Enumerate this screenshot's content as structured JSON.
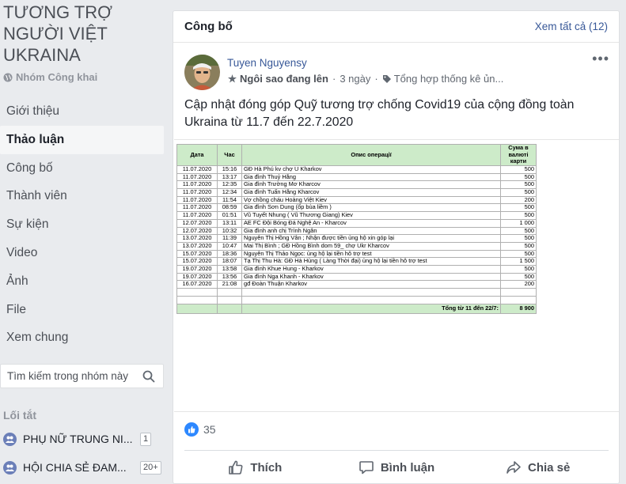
{
  "group": {
    "title": "TƯƠNG TRỢ NGƯỜI VIỆT UKRAINA",
    "privacy": "Nhóm Công khai"
  },
  "nav": [
    {
      "label": "Giới thiệu"
    },
    {
      "label": "Thảo luận"
    },
    {
      "label": "Công bố"
    },
    {
      "label": "Thành viên"
    },
    {
      "label": "Sự kiện"
    },
    {
      "label": "Video"
    },
    {
      "label": "Ảnh"
    },
    {
      "label": "File"
    },
    {
      "label": "Xem chung"
    }
  ],
  "search": {
    "placeholder": "Tìm kiếm trong nhóm này"
  },
  "shortcuts": {
    "title": "Lối tắt",
    "items": [
      {
        "label": "PHỤ NỮ TRUNG NI...",
        "badge": "1"
      },
      {
        "label": "HỘI CHIA SẺ ĐAM...",
        "badge": "20+"
      }
    ]
  },
  "card": {
    "title": "Công bố",
    "see_all": "Xem tất cả (12)"
  },
  "post": {
    "author": "Tuyen Nguyensy",
    "badge": "Ngôi sao đang lên",
    "time": "3 ngày",
    "tag": "Tổng hợp thống kê ủn...",
    "text": "Cập nhật đóng góp Quỹ tương trợ chống Covid19 của cộng đồng toàn Ukraina từ 11.7 đến 22.7.2020",
    "reaction_count": "35"
  },
  "sheet": {
    "headers": [
      "Дата",
      "Час",
      "Опис операції",
      "Сума в валюті карти"
    ],
    "rows": [
      [
        "11.07.2020",
        "15:16",
        "  GĐ Hà Phú kv  chợ U Kharkov",
        "500"
      ],
      [
        "11.07.2020",
        "13:17",
        "  Gia đình Thuỷ Hằng",
        "500"
      ],
      [
        "11.07.2020",
        "12:35",
        "Gia đình Trường Mơ Kharcov",
        "500"
      ],
      [
        "11.07.2020",
        "12:34",
        "Gia đình Tuấn Hằng Kharcov",
        "500"
      ],
      [
        "11.07.2020",
        "11:54",
        "Vợ chồng cháu Hoàng Việt Kiev",
        "200"
      ],
      [
        "11.07.2020",
        "08:59",
        "Gia đình Sơn Dung (ốp bùa liềm )",
        "500"
      ],
      [
        "11.07.2020",
        "01:51",
        "Vũ Tuyết Nhung ( Vũ Thương Giang) Kiev",
        "500"
      ],
      [
        "12.07.2020",
        "13:11",
        "AE FC Đội Bóng Đá Nghệ An - Kharcov",
        "1 000"
      ],
      [
        "12.07.2020",
        "10:32",
        "Gia đình anh chị Trình Ngân",
        "500"
      ],
      [
        "13.07.2020",
        "11:39",
        "Nguyễn Thị Hồng Vân ; Nhận được tiền ủng hộ xin góp lại",
        "500"
      ],
      [
        "13.07.2020",
        "10:47",
        "  Mai Thị Bình ; GĐ Hồng Bình dom 59_ chợ Ukr Kharcov",
        "500"
      ],
      [
        "15.07.2020",
        "18:36",
        "Nguyễn Thị Thảo Ngọc: ủng hộ lại tiền hỗ trợ test",
        "500"
      ],
      [
        "15.07.2020",
        "18:07",
        "Tạ Thị Thu Hà: GĐ Hà Hùng  ( Làng Thời đại) ủng hộ lại tiền hỗ trợ test",
        "1 500"
      ],
      [
        "19.07.2020",
        "13:58",
        "Gia đình  Khue Hung - Kharkov",
        "500"
      ],
      [
        "19.07.2020",
        "13:56",
        "Gia đình Nga Khanh - Kharkov",
        "500"
      ],
      [
        "16.07.2020",
        "21:08",
        "gđ Đoàn Thuận Kharkov",
        "200"
      ]
    ],
    "total_label": "Tổng từ 11 đến 22/7:",
    "total_value": "8 900"
  },
  "actions": {
    "like": "Thích",
    "comment": "Bình luận",
    "share": "Chia sẻ"
  },
  "colors": {
    "link": "#385898",
    "sheet_header": "#cdebc9",
    "like_blue": "#2d88ff"
  }
}
